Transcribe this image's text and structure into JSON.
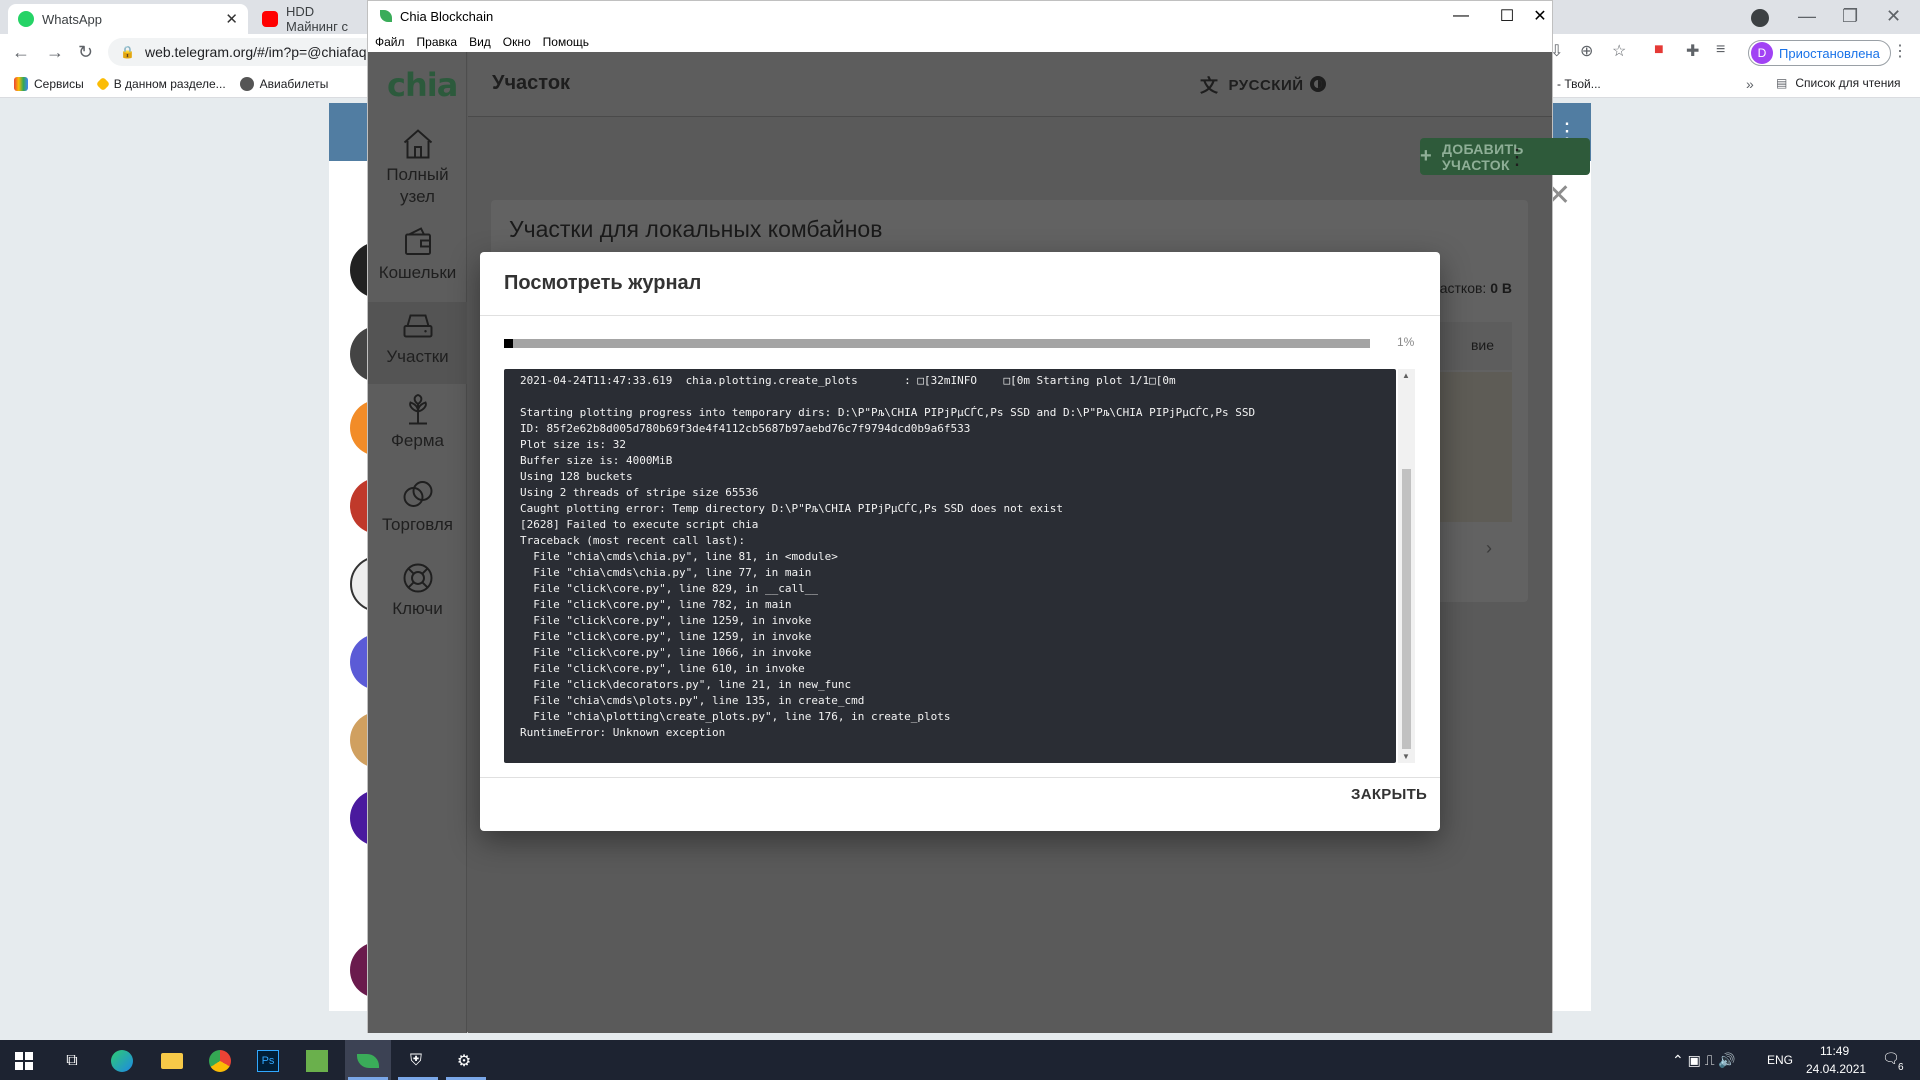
{
  "browser": {
    "tabs": [
      {
        "label": "WhatsApp"
      },
      {
        "label": "HDD Майнинг с"
      }
    ],
    "url": "web.telegram.org/#/im?p=@chiafaq",
    "profile": {
      "initial": "D",
      "label": "Приостановлена"
    },
    "bookmarks": [
      {
        "label": "Сервисы"
      },
      {
        "label": "В данном разделе..."
      },
      {
        "label": "Авиабилеты"
      }
    ],
    "bookmark_right": "- Твой...",
    "reading_list": "Список для чтения"
  },
  "window": {
    "title": "Chia Blockchain",
    "menu": [
      "Файл",
      "Правка",
      "Вид",
      "Окно",
      "Помощь"
    ]
  },
  "app": {
    "logo": "chia",
    "page_title": "Участок",
    "language": "РУССКИЙ",
    "nav": [
      {
        "label_lines": [
          "Полный",
          "узел"
        ],
        "icon": "home-icon"
      },
      {
        "label_lines": [
          "Кошельки"
        ],
        "icon": "wallet-icon"
      },
      {
        "label_lines": [
          "Участки"
        ],
        "icon": "hdd-icon"
      },
      {
        "label_lines": [
          "Ферма"
        ],
        "icon": "farm-icon"
      },
      {
        "label_lines": [
          "Торговля"
        ],
        "icon": "trade-icon"
      },
      {
        "label_lines": [
          "Ключи"
        ],
        "icon": "keys-icon"
      }
    ],
    "add_plot_label": "ДОБАВИТЬ УЧАСТОК",
    "card_title": "Участки для локальных комбайнов",
    "card_size_prefix": "астков:",
    "card_size_value": "0 B",
    "card_col_fragment": "вие"
  },
  "modal": {
    "title": "Посмотреть журнал",
    "progress_percent": 1,
    "progress_label": "1%",
    "log_lines": [
      "2021-04-24T11:47:33.619  chia.plotting.create_plots       : □[32mINFO    □[0m Starting plot 1/1□[0m",
      "",
      "Starting plotting progress into temporary dirs: D:\\P\"Рљ\\CHIA PIPjPµCЃC‚Рs SSD and D:\\P\"Рљ\\CHIA PIPjPµCЃC‚Рs SSD",
      "ID: 85f2e62b8d005d780b69f3de4f4112cb5687b97aebd76c7f9794dcd0b9a6f533",
      "Plot size is: 32",
      "Buffer size is: 4000MiB",
      "Using 128 buckets",
      "Using 2 threads of stripe size 65536",
      "Caught plotting error: Temp directory D:\\P\"Рљ\\CHIA PIPjPµCЃC‚Рs SSD does not exist",
      "[2628] Failed to execute script chia",
      "Traceback (most recent call last):",
      "  File \"chia\\cmds\\chia.py\", line 81, in <module>",
      "  File \"chia\\cmds\\chia.py\", line 77, in main",
      "  File \"click\\core.py\", line 829, in __call__",
      "  File \"click\\core.py\", line 782, in main",
      "  File \"click\\core.py\", line 1259, in invoke",
      "  File \"click\\core.py\", line 1259, in invoke",
      "  File \"click\\core.py\", line 1066, in invoke",
      "  File \"click\\core.py\", line 610, in invoke",
      "  File \"click\\decorators.py\", line 21, in new_func",
      "  File \"chia\\cmds\\plots.py\", line 135, in create_cmd",
      "  File \"chia\\plotting\\create_plots.py\", line 176, in create_plots",
      "RuntimeError: Unknown exception"
    ],
    "close_label": "ЗАКРЫТЬ"
  },
  "taskbar": {
    "lang": "ENG",
    "time": "11:49",
    "date": "24.04.2021",
    "notifications": "6"
  },
  "colors": {
    "chia_green": "#3aac59",
    "add_button": "#2e5a3a",
    "log_bg": "#2a2d34",
    "telegram_blue": "#517da2",
    "taskbar": "#1d2331"
  }
}
